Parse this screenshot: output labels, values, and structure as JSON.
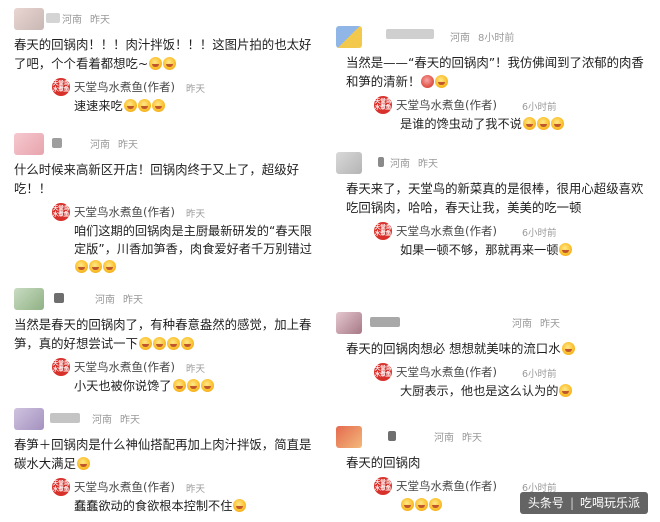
{
  "author_reply_name": "天堂鸟水煮鱼(作者)",
  "author_logo_text": "天堂鸟水煮鱼",
  "left_comments": [
    {
      "location": "河南",
      "time": "昨天",
      "text": "春天的回锅肉！！！肉汁拌饭！！！这图片拍的也太好了吧，个个看着都想吃~",
      "emojis": 2,
      "reply": {
        "time": "昨天",
        "text": "速速来吃",
        "emojis": 3
      }
    },
    {
      "location": "河南",
      "time": "昨天",
      "text": "什么时候来高新区开店！回锅肉终于又上了，超级好吃！！",
      "emojis": 0,
      "reply": {
        "time": "昨天",
        "text": "咱们这期的回锅肉是主厨最新研发的“春天限定版”，川香加笋香，肉食爱好者千万别错过",
        "emojis": 3
      }
    },
    {
      "location": "河南",
      "time": "昨天",
      "text": "当然是春天的回锅肉了，有种春意盎然的感觉，加上春笋，真的好想尝试一下",
      "emojis": 4,
      "reply": {
        "time": "昨天",
        "text": "小天也被你说馋了",
        "emojis": 3
      }
    },
    {
      "location": "河南",
      "time": "昨天",
      "text": "春笋＋回锅肉是什么神仙搭配再加上肉汁拌饭，简直是碳水大满足",
      "emojis": 1,
      "reply": {
        "time": "昨天",
        "text": "蠢蠢欲动的食欲根本控制不住",
        "emojis": 1
      }
    }
  ],
  "right_comments": [
    {
      "location": "河南",
      "time": "8小时前",
      "text": "当然是——“春天的回锅肉”！我仿佛闻到了浓郁的肉香和笋的清新！",
      "emojis": 1,
      "reply": {
        "time": "6小时前",
        "text": "是谁的馋虫动了我不说",
        "emojis": 3
      }
    },
    {
      "location": "河南",
      "time": "昨天",
      "text": "春天来了，天堂鸟的新菜真的是很棒，很用心超级喜欢吃回锅肉，哈哈，春天让我，美美的吃一顿",
      "emojis": 0,
      "reply": {
        "time": "6小时前",
        "text": "如果一顿不够，那就再来一顿",
        "emojis": 1
      }
    },
    {
      "location": "河南",
      "time": "昨天",
      "text": "春天的回锅肉想必 想想就美味的流口水",
      "emojis": 1,
      "reply": {
        "time": "6小时前",
        "text": "大厨表示，他也是这么认为的",
        "emojis": 1
      }
    },
    {
      "location": "河南",
      "time": "昨天",
      "text": "春天的回锅肉",
      "emojis": 0,
      "reply": {
        "time": "6小时前",
        "text": "",
        "emojis": 3
      }
    }
  ],
  "watermark": {
    "platform": "头条号",
    "account": "吃喝玩乐派"
  },
  "colors": {
    "text": "#1f1f1f",
    "meta": "#9a9a9a",
    "logo": "#d8302b",
    "emoji": "#fbc02d"
  }
}
